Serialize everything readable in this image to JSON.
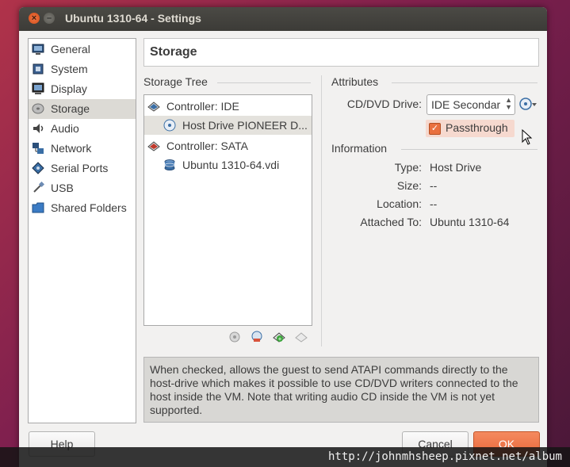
{
  "window": {
    "title": "Ubuntu 1310-64 - Settings"
  },
  "sidebar": {
    "items": [
      {
        "label": "General",
        "icon": "monitor-general-icon"
      },
      {
        "label": "System",
        "icon": "chip-icon"
      },
      {
        "label": "Display",
        "icon": "display-icon"
      },
      {
        "label": "Storage",
        "icon": "disk-icon",
        "selected": true
      },
      {
        "label": "Audio",
        "icon": "speaker-icon"
      },
      {
        "label": "Network",
        "icon": "network-icon"
      },
      {
        "label": "Serial Ports",
        "icon": "serial-port-icon"
      },
      {
        "label": "USB",
        "icon": "usb-icon"
      },
      {
        "label": "Shared Folders",
        "icon": "folder-icon"
      }
    ]
  },
  "page": {
    "title": "Storage"
  },
  "storage_tree": {
    "label": "Storage Tree",
    "rows": [
      {
        "label": "Controller: IDE",
        "icon": "ide-controller-icon"
      },
      {
        "label": "Host Drive PIONEER D...",
        "icon": "cd-icon",
        "selected": true
      },
      {
        "label": "Controller: SATA",
        "icon": "sata-controller-icon"
      },
      {
        "label": "Ubuntu 1310-64.vdi",
        "icon": "hard-disk-icon"
      }
    ],
    "tools": [
      "add-attachment-icon",
      "remove-attachment-icon",
      "add-controller-icon",
      "remove-controller-icon"
    ]
  },
  "attributes": {
    "label": "Attributes",
    "cd_drive_label": "CD/DVD Drive:",
    "cd_drive_value": "IDE Secondar",
    "passthrough_label": "Passthrough",
    "passthrough_checked": true
  },
  "information": {
    "label": "Information",
    "rows": [
      {
        "key": "Type:",
        "value": "Host Drive"
      },
      {
        "key": "Size:",
        "value": "--"
      },
      {
        "key": "Location:",
        "value": "--"
      },
      {
        "key": "Attached To:",
        "value": "Ubuntu 1310-64"
      }
    ]
  },
  "help_text": "When checked, allows the guest to send ATAPI commands directly to the host-drive which makes it possible to use CD/DVD writers connected to the host inside the VM. Note that writing audio CD inside the VM is not yet supported.",
  "buttons": {
    "help": "Help",
    "cancel": "Cancel",
    "ok": "OK"
  },
  "watermark": "http://johnmhsheep.pixnet.net/album",
  "colors": {
    "accent": "#e9683a",
    "titlebar": "#3c3b37"
  }
}
